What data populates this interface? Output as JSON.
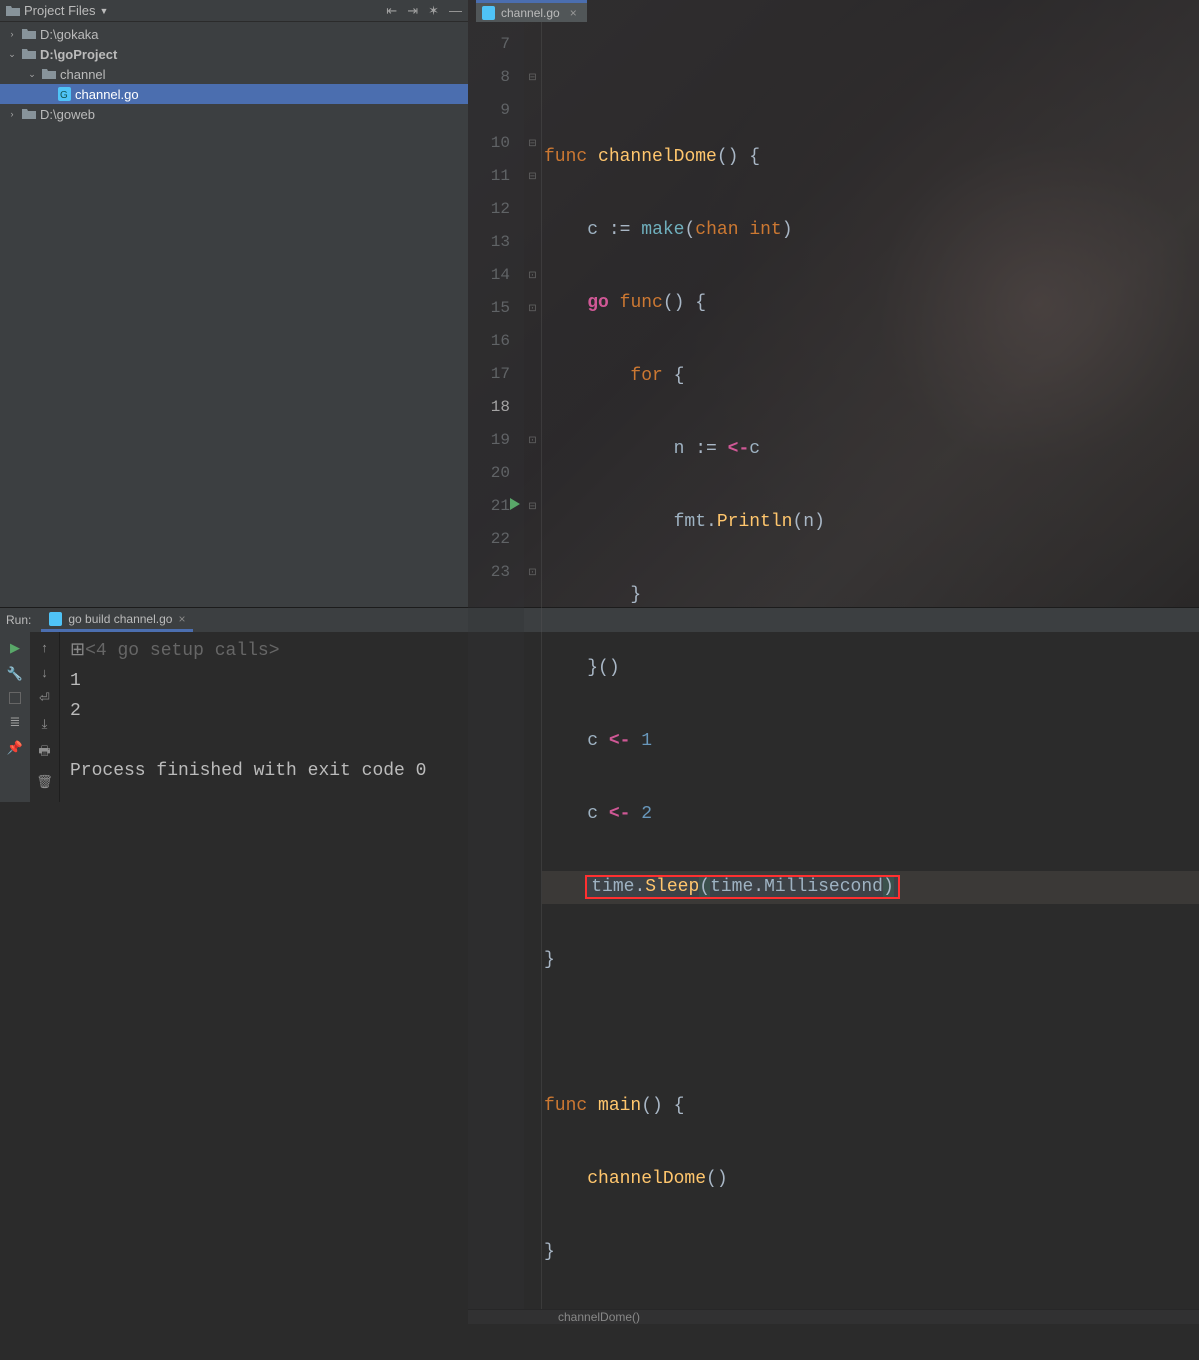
{
  "sidebar": {
    "title": "Project Files",
    "tree": [
      {
        "label": "D:\\gokaka"
      },
      {
        "label": "D:\\goProject"
      },
      {
        "label": "channel"
      },
      {
        "label": "channel.go"
      },
      {
        "label": "D:\\goweb"
      }
    ]
  },
  "tab": {
    "label": "channel.go"
  },
  "gutter": {
    "lines": [
      7,
      8,
      9,
      10,
      11,
      12,
      13,
      14,
      15,
      16,
      17,
      18,
      19,
      20,
      21,
      22,
      23
    ]
  },
  "code": {
    "l8": {
      "kw": "func",
      "fn": "channelDome",
      "rest": "() {"
    },
    "l9": {
      "id1": "c",
      "op": ":=",
      "make": "make",
      "chan": "chan",
      "int": "int"
    },
    "l10": {
      "go": "go",
      "kw": "func",
      "rest": "() {"
    },
    "l11": {
      "kw": "for",
      "rest": " {"
    },
    "l12": {
      "id": "n",
      "op": ":=",
      "arrow": "<-",
      "c": "c"
    },
    "l13": {
      "pkg": "fmt",
      "dot": ".",
      "fn": "Println",
      "arg": "(n)"
    },
    "l14": {
      "text": "}"
    },
    "l15": {
      "text": "}()"
    },
    "l16": {
      "c": "c",
      "arrow": "<-",
      "num": "1"
    },
    "l17": {
      "c": "c",
      "arrow": "<-",
      "num": "2"
    },
    "l18": {
      "pkg": "time",
      "dot": ".",
      "fn": "Sleep",
      "pkg2": "time",
      "dot2": ".",
      "field": "Millisecond"
    },
    "l19": {
      "text": "}"
    },
    "l21": {
      "kw": "func",
      "fn": "main",
      "rest": "() {"
    },
    "l22": {
      "fn": "channelDome",
      "rest": "()"
    },
    "l23": {
      "text": "}"
    }
  },
  "breadcrumb": "channelDome()",
  "run": {
    "label": "Run:",
    "tab": "go build channel.go",
    "out_setup": "<4 go setup calls>",
    "out1": "1",
    "out2": "2",
    "finished": "Process finished with exit code 0"
  }
}
